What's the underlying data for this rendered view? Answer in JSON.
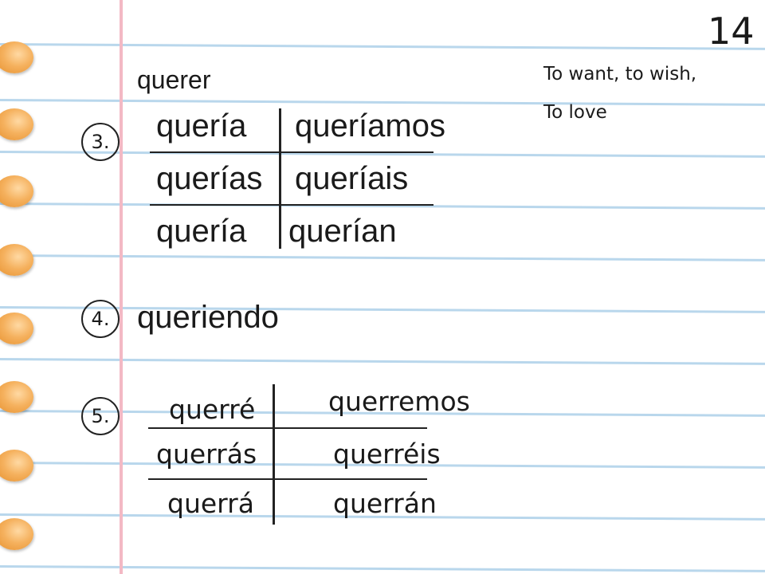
{
  "page_number": "14",
  "verb": "querer",
  "meaning": [
    "To want, to wish,",
    "To love"
  ],
  "sections": {
    "imperfect": {
      "number": "3.",
      "cells": [
        "quería",
        "queríamos",
        "querías",
        "queríais",
        "quería",
        "querían"
      ]
    },
    "gerund": {
      "number": "4.",
      "form": "queriendo"
    },
    "future": {
      "number": "5.",
      "cells": [
        "querré",
        "querremos",
        "querrás",
        "querréis",
        "querrá",
        "querrán"
      ]
    }
  }
}
